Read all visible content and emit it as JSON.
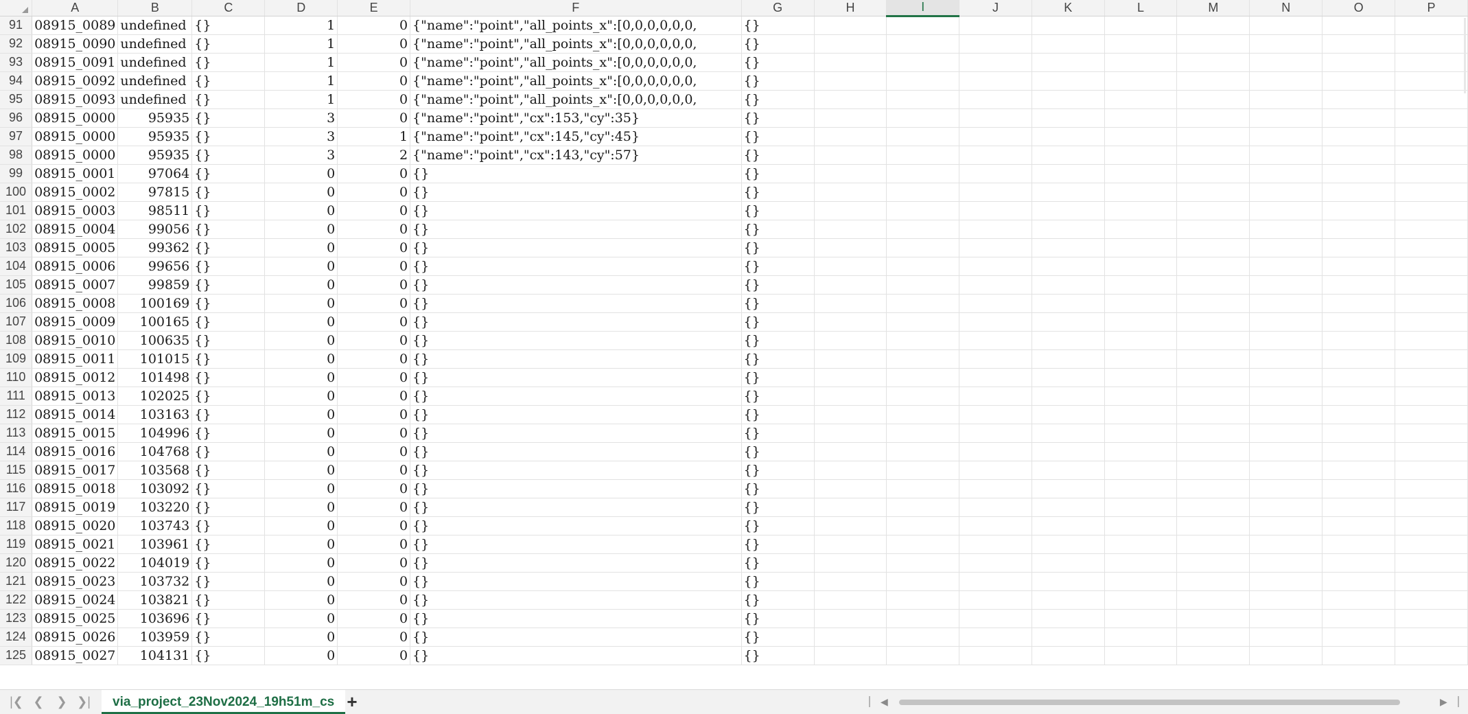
{
  "columns": [
    "A",
    "B",
    "C",
    "D",
    "E",
    "F",
    "G",
    "H",
    "I",
    "J",
    "K",
    "L",
    "M",
    "N",
    "O",
    "P"
  ],
  "selected_column": "I",
  "rows": [
    {
      "n": "91",
      "a": "08915_0089",
      "b": "undefined",
      "c": "{}",
      "d": "1",
      "e": "0",
      "f": "{\"name\":\"point\",\"all_points_x\":[0,0,0,0,0,0,",
      "g": "{}"
    },
    {
      "n": "92",
      "a": "08915_0090",
      "b": "undefined",
      "c": "{}",
      "d": "1",
      "e": "0",
      "f": "{\"name\":\"point\",\"all_points_x\":[0,0,0,0,0,0,",
      "g": "{}"
    },
    {
      "n": "93",
      "a": "08915_0091",
      "b": "undefined",
      "c": "{}",
      "d": "1",
      "e": "0",
      "f": "{\"name\":\"point\",\"all_points_x\":[0,0,0,0,0,0,",
      "g": "{}"
    },
    {
      "n": "94",
      "a": "08915_0092",
      "b": "undefined",
      "c": "{}",
      "d": "1",
      "e": "0",
      "f": "{\"name\":\"point\",\"all_points_x\":[0,0,0,0,0,0,",
      "g": "{}"
    },
    {
      "n": "95",
      "a": "08915_0093",
      "b": "undefined",
      "c": "{}",
      "d": "1",
      "e": "0",
      "f": "{\"name\":\"point\",\"all_points_x\":[0,0,0,0,0,0,",
      "g": "{}"
    },
    {
      "n": "96",
      "a": "08915_0000",
      "b": "95935",
      "c": "{}",
      "d": "3",
      "e": "0",
      "f": "{\"name\":\"point\",\"cx\":153,\"cy\":35}",
      "g": "{}"
    },
    {
      "n": "97",
      "a": "08915_0000",
      "b": "95935",
      "c": "{}",
      "d": "3",
      "e": "1",
      "f": "{\"name\":\"point\",\"cx\":145,\"cy\":45}",
      "g": "{}"
    },
    {
      "n": "98",
      "a": "08915_0000",
      "b": "95935",
      "c": "{}",
      "d": "3",
      "e": "2",
      "f": "{\"name\":\"point\",\"cx\":143,\"cy\":57}",
      "g": "{}"
    },
    {
      "n": "99",
      "a": "08915_0001",
      "b": "97064",
      "c": "{}",
      "d": "0",
      "e": "0",
      "f": "{}",
      "g": "{}"
    },
    {
      "n": "100",
      "a": "08915_0002",
      "b": "97815",
      "c": "{}",
      "d": "0",
      "e": "0",
      "f": "{}",
      "g": "{}"
    },
    {
      "n": "101",
      "a": "08915_0003",
      "b": "98511",
      "c": "{}",
      "d": "0",
      "e": "0",
      "f": "{}",
      "g": "{}"
    },
    {
      "n": "102",
      "a": "08915_0004",
      "b": "99056",
      "c": "{}",
      "d": "0",
      "e": "0",
      "f": "{}",
      "g": "{}"
    },
    {
      "n": "103",
      "a": "08915_0005",
      "b": "99362",
      "c": "{}",
      "d": "0",
      "e": "0",
      "f": "{}",
      "g": "{}"
    },
    {
      "n": "104",
      "a": "08915_0006",
      "b": "99656",
      "c": "{}",
      "d": "0",
      "e": "0",
      "f": "{}",
      "g": "{}"
    },
    {
      "n": "105",
      "a": "08915_0007",
      "b": "99859",
      "c": "{}",
      "d": "0",
      "e": "0",
      "f": "{}",
      "g": "{}"
    },
    {
      "n": "106",
      "a": "08915_0008",
      "b": "100169",
      "c": "{}",
      "d": "0",
      "e": "0",
      "f": "{}",
      "g": "{}"
    },
    {
      "n": "107",
      "a": "08915_0009",
      "b": "100165",
      "c": "{}",
      "d": "0",
      "e": "0",
      "f": "{}",
      "g": "{}"
    },
    {
      "n": "108",
      "a": "08915_0010",
      "b": "100635",
      "c": "{}",
      "d": "0",
      "e": "0",
      "f": "{}",
      "g": "{}"
    },
    {
      "n": "109",
      "a": "08915_0011",
      "b": "101015",
      "c": "{}",
      "d": "0",
      "e": "0",
      "f": "{}",
      "g": "{}"
    },
    {
      "n": "110",
      "a": "08915_0012",
      "b": "101498",
      "c": "{}",
      "d": "0",
      "e": "0",
      "f": "{}",
      "g": "{}"
    },
    {
      "n": "111",
      "a": "08915_0013",
      "b": "102025",
      "c": "{}",
      "d": "0",
      "e": "0",
      "f": "{}",
      "g": "{}"
    },
    {
      "n": "112",
      "a": "08915_0014",
      "b": "103163",
      "c": "{}",
      "d": "0",
      "e": "0",
      "f": "{}",
      "g": "{}"
    },
    {
      "n": "113",
      "a": "08915_0015",
      "b": "104996",
      "c": "{}",
      "d": "0",
      "e": "0",
      "f": "{}",
      "g": "{}"
    },
    {
      "n": "114",
      "a": "08915_0016",
      "b": "104768",
      "c": "{}",
      "d": "0",
      "e": "0",
      "f": "{}",
      "g": "{}"
    },
    {
      "n": "115",
      "a": "08915_0017",
      "b": "103568",
      "c": "{}",
      "d": "0",
      "e": "0",
      "f": "{}",
      "g": "{}"
    },
    {
      "n": "116",
      "a": "08915_0018",
      "b": "103092",
      "c": "{}",
      "d": "0",
      "e": "0",
      "f": "{}",
      "g": "{}"
    },
    {
      "n": "117",
      "a": "08915_0019",
      "b": "103220",
      "c": "{}",
      "d": "0",
      "e": "0",
      "f": "{}",
      "g": "{}"
    },
    {
      "n": "118",
      "a": "08915_0020",
      "b": "103743",
      "c": "{}",
      "d": "0",
      "e": "0",
      "f": "{}",
      "g": "{}"
    },
    {
      "n": "119",
      "a": "08915_0021",
      "b": "103961",
      "c": "{}",
      "d": "0",
      "e": "0",
      "f": "{}",
      "g": "{}"
    },
    {
      "n": "120",
      "a": "08915_0022",
      "b": "104019",
      "c": "{}",
      "d": "0",
      "e": "0",
      "f": "{}",
      "g": "{}"
    },
    {
      "n": "121",
      "a": "08915_0023",
      "b": "103732",
      "c": "{}",
      "d": "0",
      "e": "0",
      "f": "{}",
      "g": "{}"
    },
    {
      "n": "122",
      "a": "08915_0024",
      "b": "103821",
      "c": "{}",
      "d": "0",
      "e": "0",
      "f": "{}",
      "g": "{}"
    },
    {
      "n": "123",
      "a": "08915_0025",
      "b": "103696",
      "c": "{}",
      "d": "0",
      "e": "0",
      "f": "{}",
      "g": "{}"
    },
    {
      "n": "124",
      "a": "08915_0026",
      "b": "103959",
      "c": "{}",
      "d": "0",
      "e": "0",
      "f": "{}",
      "g": "{}"
    },
    {
      "n": "125",
      "a": "08915_0027",
      "b": "104131",
      "c": "{}",
      "d": "0",
      "e": "0",
      "f": "{}",
      "g": "{}"
    }
  ],
  "sheet_tab": {
    "label": "via_project_23Nov2024_19h51m_cs"
  },
  "nav": {
    "first_icon": "first-sheet-icon",
    "prev_icon": "prev-sheet-icon",
    "next_icon": "next-sheet-icon",
    "last_icon": "last-sheet-icon",
    "add_icon": "plus-icon"
  },
  "colors": {
    "accent": "#1e6e45",
    "header_bg": "#f3f3f3",
    "gridline": "#e2e2e2"
  }
}
